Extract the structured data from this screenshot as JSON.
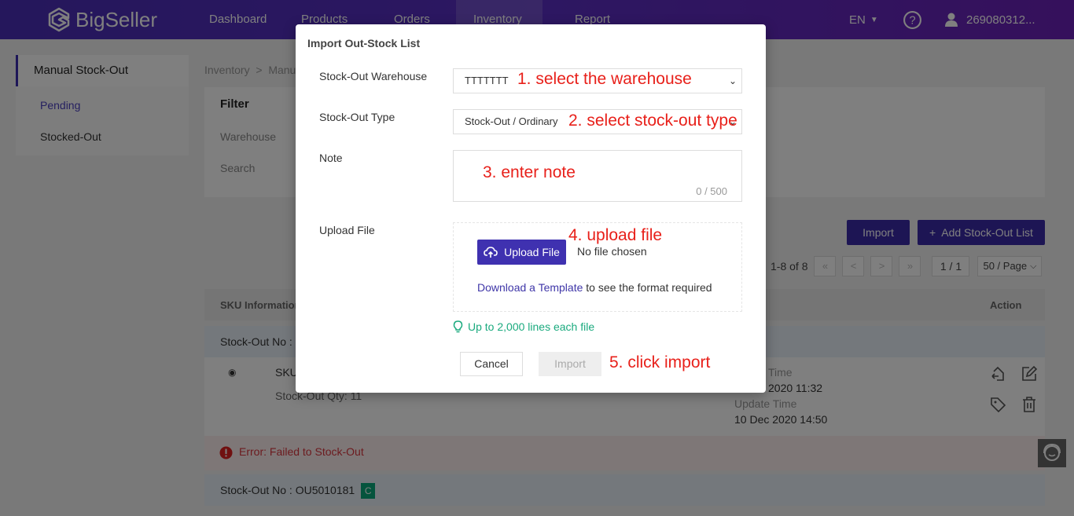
{
  "nav": {
    "brand": "BigSeller",
    "items": [
      {
        "label": "Dashboard"
      },
      {
        "label": "Products"
      },
      {
        "label": "Orders"
      },
      {
        "label": "Inventory",
        "active": true
      },
      {
        "label": "Report"
      }
    ],
    "language": "EN",
    "user": "269080312..."
  },
  "sidebar": {
    "title": "Manual Stock-Out",
    "items": [
      {
        "label": "Pending",
        "active": true
      },
      {
        "label": "Stocked-Out"
      }
    ]
  },
  "breadcrumb": "Inventory  >  Manual",
  "filter": {
    "title": "Filter",
    "warehouse_label": "Warehouse",
    "search_label": "Search"
  },
  "toolbar": {
    "import_label": "Import",
    "add_label": "+  Add Stock-Out List"
  },
  "pager": {
    "summary": "1-8 of 8",
    "first": "«",
    "prev": "<",
    "next": ">",
    "last": "»",
    "page": "1 / 1",
    "page_size": "50 / Page"
  },
  "table": {
    "headers": {
      "sku": "SKU Information",
      "action": "Action"
    },
    "rows": [
      {
        "stock_out_no_label": "Stock-Out No : ",
        "sku_label": "SKU",
        "qty_text": "Stock-Out Qty: 11",
        "create_time_label": "Time",
        "create_time": "2020 11:32",
        "update_time_label": "Update Time",
        "update_time": "10 Dec 2020 14:50",
        "error": "Error: Failed to Stock-Out"
      },
      {
        "stock_out_no_label": "Stock-Out No : OU5010181",
        "badge": "C"
      }
    ]
  },
  "modal": {
    "title": "Import Out-Stock List",
    "warehouse_label": "Stock-Out Warehouse",
    "warehouse_value": "TTTTTTT",
    "type_label": "Stock-Out Type",
    "type_value": "Stock-Out / Ordinary",
    "note_label": "Note",
    "note_counter": "0 / 500",
    "upload_label": "Upload File",
    "upload_button": "Upload File",
    "no_file": "No file chosen",
    "template_link": "Download a Template",
    "template_suffix": " to see the format required",
    "tip": "Up to 2,000 lines each file",
    "cancel": "Cancel",
    "import": "Import"
  },
  "annotations": {
    "step1": "1. select the warehouse",
    "step2": "2. select stock-out type",
    "step3": "3. enter note",
    "step4": "4. upload file",
    "step5": "5. click import"
  }
}
